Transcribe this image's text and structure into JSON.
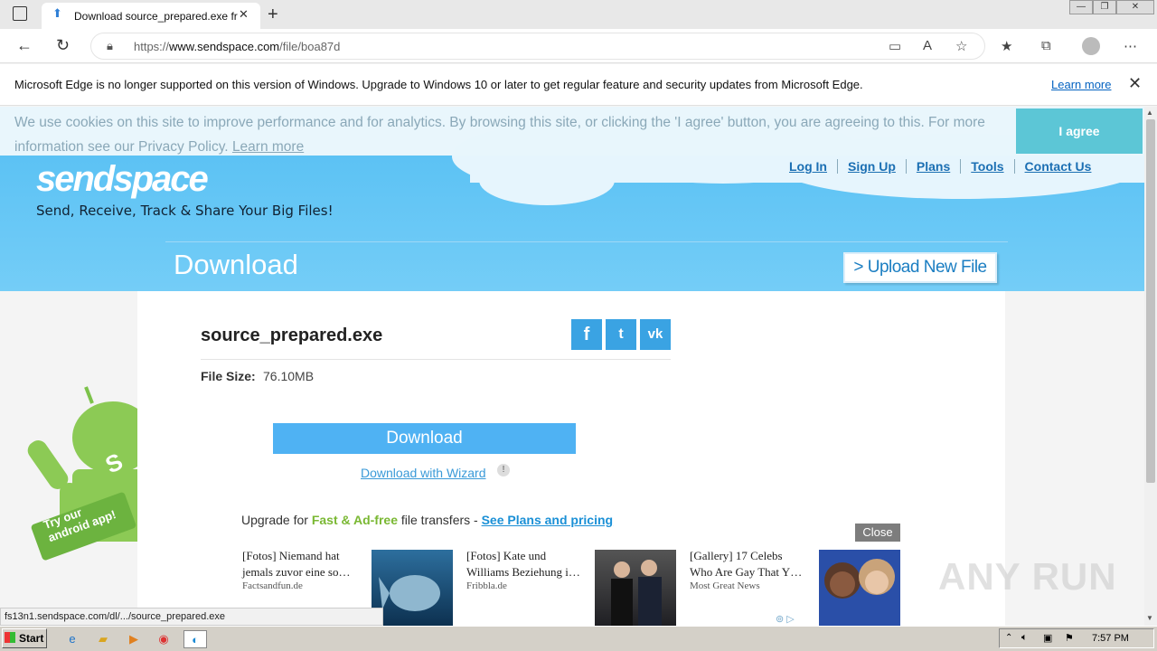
{
  "browser": {
    "tab_title": "Download source_prepared.exe fr",
    "new_tab": "+",
    "url_prefix": "https://",
    "url_host": "www.sendspace.com",
    "url_path": "/file/boa87d",
    "window_buttons": [
      "—",
      "❐",
      "✕"
    ]
  },
  "notice": {
    "text": "Microsoft Edge is no longer supported on this version of Windows. Upgrade to Windows 10 or later to get regular feature and security updates from Microsoft Edge.",
    "link": "Learn more"
  },
  "cookie": {
    "text": "We use cookies on this site to improve performance and for analytics. By browsing this site, or clicking the 'I agree' button, you are agreeing to this. For more information see our Privacy Policy.",
    "link": "Learn more",
    "agree": "I agree"
  },
  "site": {
    "logo": "sendspace",
    "tagline": "Send, Receive, Track & Share Your Big Files!",
    "nav": [
      "Log In",
      "Sign Up",
      "Plans",
      "Tools",
      "Contact Us"
    ],
    "page_title": "Download",
    "upload_button": "> Upload New File"
  },
  "file": {
    "name": "source_prepared.exe",
    "size_label": "File Size:",
    "size_value": "76.10MB",
    "social": [
      "f",
      "t",
      "vk"
    ]
  },
  "download": {
    "button": "Download",
    "wizard_link": "Download with Wizard",
    "help": "!"
  },
  "upgrade": {
    "prefix": "Upgrade for ",
    "highlight": "Fast & Ad-free",
    "middle": " file transfers - ",
    "link": "See Plans and pricing"
  },
  "ads": {
    "close": "Close",
    "items": [
      {
        "title": "[Fotos] Niemand hat jemals zuvor eine so…",
        "source": "Factsandfun.de"
      },
      {
        "title": "[Fotos] Kate und Williams Beziehung i…",
        "source": "Fribbla.de"
      },
      {
        "title": "[Gallery] 17 Celebs Who Are Gay That Y…",
        "source": "Most Great News"
      }
    ]
  },
  "android_promo": {
    "line1": "Try our",
    "line2": "android app!"
  },
  "watermark": "ANY RUN",
  "status_url": "fs13n1.sendspace.com/dl/.../source_prepared.exe",
  "taskbar": {
    "start": "Start",
    "clock": "7:57 PM"
  },
  "colors": {
    "sky_blue": "#5cc2f4",
    "button_blue": "#4fb2f3",
    "accent_green": "#7ab833",
    "agree_teal": "#5cc6d6"
  }
}
